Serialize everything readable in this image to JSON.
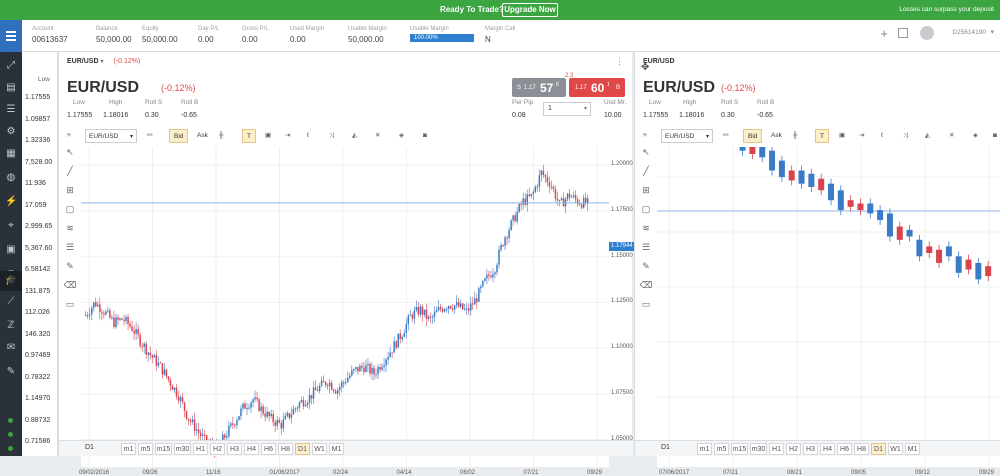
{
  "banner": {
    "cta_text": "Ready To Trade?",
    "upgrade_label": "Upgrade Now",
    "risk_warning": "Losses can surpass your deposit"
  },
  "account": {
    "fields": [
      {
        "label": "Account",
        "value": "00613637"
      },
      {
        "label": "Balance",
        "value": "50,000.00"
      },
      {
        "label": "Equity",
        "value": "50,000.00"
      },
      {
        "label": "Day P/L",
        "value": "0.00"
      },
      {
        "label": "Gross P/L",
        "value": "0.00"
      },
      {
        "label": "Used Margin",
        "value": "0.00"
      },
      {
        "label": "Usable Margin",
        "value": "50,000.00"
      },
      {
        "label": "Usable Margin",
        "value": "100.00%"
      },
      {
        "label": "Margin Call",
        "value": "N"
      }
    ],
    "user": "D25614190"
  },
  "price_column": {
    "header": "Low",
    "prices": [
      "1.17555",
      "1.09857",
      "1.32336",
      "7,528.00",
      "11.936",
      "17.059",
      "2,999.65",
      "5,367.60",
      "6.58142",
      "131.875",
      "112.026",
      "146.320",
      "0.97469",
      "0.78322",
      "1.14970",
      "0.88732",
      "0.71586"
    ]
  },
  "panel_left": {
    "header_symbol": "EUR/USD",
    "header_change": "(-0.12%)",
    "symbol": "EUR/USD",
    "change": "(-0.12%)",
    "stats": [
      {
        "label": "Low",
        "value": "1.17555"
      },
      {
        "label": "High",
        "value": "1.18016"
      },
      {
        "label": "Roll S",
        "value": "0.30"
      },
      {
        "label": "Roll B",
        "value": "-0.65"
      }
    ],
    "sell": {
      "prefix": "S",
      "small": "1.17",
      "big": "57",
      "sup": "8"
    },
    "buy": {
      "prefix": "B",
      "small": "1.17",
      "big": "60",
      "sup": "1"
    },
    "spread": "2.3",
    "per_pip_label": "Per Pip",
    "per_pip_value": "0.08",
    "amount": "1",
    "used_mr_label": "Usd Mr.",
    "used_mr_value": "10.00",
    "toolbar": {
      "instrument": "EUR/USD",
      "bid": "Bid",
      "ask": "Ask"
    },
    "x_ticks": [
      "09/02/2016",
      "09/26",
      "11/16",
      "01/06/2017",
      "02/24",
      "04/14",
      "06/02",
      "07/21",
      "09/29"
    ],
    "y_ticks": [
      "1.20000",
      "1.17500",
      "1.15000",
      "1.12500",
      "1.10000",
      "1.07500",
      "1.05000"
    ],
    "current_price": "1.17944",
    "timeframes": [
      "D1",
      "m1",
      "m5",
      "m15",
      "m30",
      "H1",
      "H2",
      "H3",
      "H4",
      "H6",
      "H8",
      "D1",
      "W1",
      "M1"
    ],
    "active_timeframe_index": 11
  },
  "panel_right": {
    "header_symbol": "EUR/USD",
    "symbol": "EUR/USD",
    "change": "(-0.12%)",
    "stats": [
      {
        "label": "Low",
        "value": "1.17555"
      },
      {
        "label": "High",
        "value": "1.18016"
      },
      {
        "label": "Roll S",
        "value": "0.30"
      },
      {
        "label": "Roll B",
        "value": "-0.65"
      }
    ],
    "toolbar": {
      "instrument": "EUR/USD",
      "bid": "Bid",
      "ask": "Ask"
    },
    "x_ticks": [
      "07/06/2017",
      "07/21",
      "08/21",
      "09/05",
      "09/12",
      "09/29"
    ],
    "timeframes": [
      "D1",
      "m1",
      "m5",
      "m15",
      "m30",
      "H1",
      "H2",
      "H3",
      "H4",
      "H6",
      "H8",
      "D1",
      "W1",
      "M1"
    ],
    "active_timeframe_index": 11
  },
  "chart_data": [
    {
      "type": "candlestick",
      "instrument": "EUR/USD",
      "timeframe": "D1",
      "x_ticks": [
        "09/02/2016",
        "09/26",
        "11/16",
        "01/06/2017",
        "02/24",
        "04/14",
        "06/02",
        "07/21",
        "09/29"
      ],
      "y_ticks": [
        1.2,
        1.175,
        1.15,
        1.125,
        1.1,
        1.075,
        1.05
      ],
      "ylim": [
        1.035,
        1.21
      ],
      "close_path": [
        1.118,
        1.125,
        1.12,
        1.114,
        1.116,
        1.111,
        1.103,
        1.096,
        1.09,
        1.082,
        1.074,
        1.062,
        1.055,
        1.048,
        1.044,
        1.052,
        1.06,
        1.068,
        1.072,
        1.066,
        1.061,
        1.058,
        1.064,
        1.07,
        1.073,
        1.078,
        1.082,
        1.077,
        1.083,
        1.088,
        1.09,
        1.086,
        1.093,
        1.1,
        1.108,
        1.118,
        1.121,
        1.115,
        1.121,
        1.124,
        1.123,
        1.12,
        1.127,
        1.137,
        1.144,
        1.16,
        1.17,
        1.18,
        1.183,
        1.196,
        1.19,
        1.178,
        1.184,
        1.18,
        1.179
      ],
      "current": 1.17944
    },
    {
      "type": "candlestick",
      "instrument": "EUR/USD",
      "timeframe": "D1",
      "x_ticks": [
        "07/06/2017",
        "07/21",
        "08/21",
        "09/05",
        "09/12",
        "09/29"
      ],
      "candles": [
        [
          0.5,
          0.44,
          "d"
        ],
        [
          0.46,
          0.38,
          "u"
        ],
        [
          0.5,
          0.4,
          "u"
        ],
        [
          0.48,
          0.42,
          "d"
        ],
        [
          0.46,
          0.36,
          "u"
        ],
        [
          0.44,
          0.34,
          "u"
        ],
        [
          0.46,
          0.4,
          "d"
        ],
        [
          0.42,
          0.34,
          "u"
        ],
        [
          0.36,
          0.22,
          "u"
        ],
        [
          0.28,
          0.2,
          "d"
        ],
        [
          0.26,
          0.18,
          "u"
        ],
        [
          0.22,
          0.1,
          "u"
        ],
        [
          0.16,
          0.06,
          "u"
        ],
        [
          0.1,
          0.04,
          "d"
        ],
        [
          0.1,
          0.02,
          "u"
        ],
        [
          0.08,
          0.0,
          "u"
        ],
        [
          0.05,
          -0.02,
          "d"
        ],
        [
          0.02,
          -0.08,
          "u"
        ],
        [
          -0.02,
          -0.14,
          "u"
        ],
        [
          -0.08,
          -0.12,
          "d"
        ],
        [
          -0.1,
          -0.14,
          "d"
        ],
        [
          -0.1,
          -0.16,
          "u"
        ],
        [
          -0.14,
          -0.2,
          "u"
        ],
        [
          -0.16,
          -0.3,
          "u"
        ],
        [
          -0.24,
          -0.32,
          "d"
        ],
        [
          -0.26,
          -0.3,
          "u"
        ],
        [
          -0.32,
          -0.42,
          "u"
        ],
        [
          -0.36,
          -0.4,
          "d"
        ],
        [
          -0.38,
          -0.46,
          "d"
        ],
        [
          -0.36,
          -0.42,
          "u"
        ],
        [
          -0.42,
          -0.52,
          "u"
        ],
        [
          -0.44,
          -0.5,
          "d"
        ],
        [
          -0.46,
          -0.56,
          "u"
        ],
        [
          -0.48,
          -0.54,
          "d"
        ]
      ]
    }
  ]
}
